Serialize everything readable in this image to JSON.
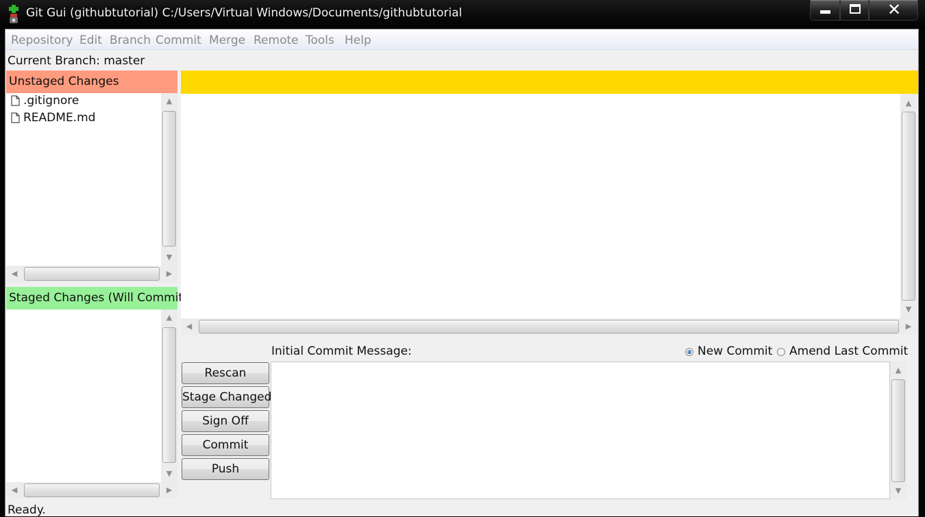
{
  "window": {
    "title": "Git Gui (githubtutorial) C:/Users/Virtual Windows/Documents/githubtutorial",
    "close_glyph": "✕"
  },
  "menu": {
    "items": [
      "Repository",
      "Edit",
      "Branch",
      "Commit",
      "Merge",
      "Remote",
      "Tools",
      "Help"
    ]
  },
  "branch": {
    "label": "Current Branch: master"
  },
  "unstaged": {
    "header": "Unstaged Changes",
    "files": [
      ".gitignore",
      "README.md"
    ]
  },
  "staged": {
    "header": "Staged Changes (Will Commit)",
    "files": []
  },
  "commit": {
    "message_label": "Initial Commit Message:",
    "options": [
      {
        "label": "New Commit",
        "checked": true
      },
      {
        "label": "Amend Last Commit",
        "checked": false
      }
    ],
    "message": ""
  },
  "buttons": {
    "rescan": "Rescan",
    "stage_changed": "Stage Changed",
    "sign_off": "Sign Off",
    "commit": "Commit",
    "push": "Push"
  },
  "status": {
    "text": "Ready."
  },
  "icons": {
    "app": "git-gui-icon",
    "file": "file-icon",
    "minimize": "minimize-icon",
    "maximize": "maximize-icon",
    "close": "close-icon"
  },
  "colors": {
    "unstaged_header": "#fe9a7d",
    "staged_header": "#98f098",
    "diff_header": "#ffd800",
    "menu_text": "#8a8a8a"
  }
}
